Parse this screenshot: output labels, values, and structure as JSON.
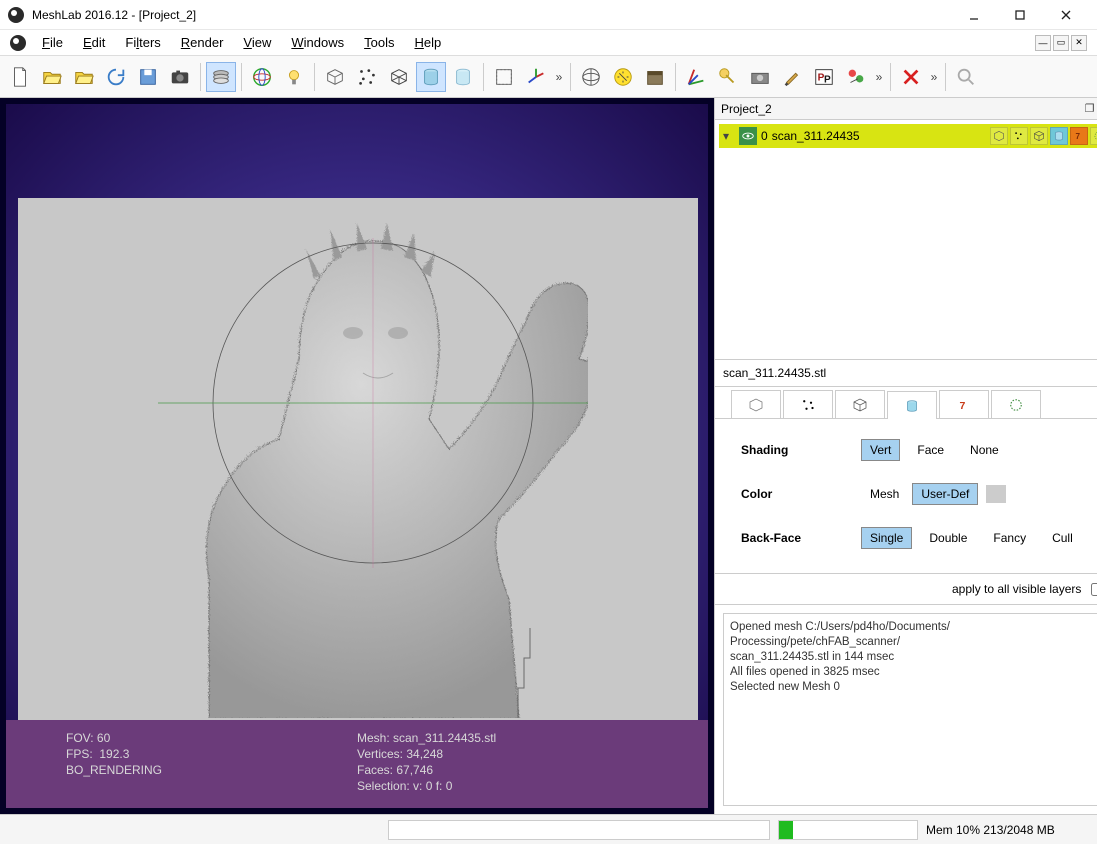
{
  "title": "MeshLab 2016.12 - [Project_2]",
  "menu": [
    "File",
    "Edit",
    "Filters",
    "Render",
    "View",
    "Windows",
    "Tools",
    "Help"
  ],
  "panel": {
    "title": "Project_2",
    "layer": {
      "index": "0",
      "name": "scan_311.24435"
    },
    "mesh_label": "scan_311.24435.stl"
  },
  "shading": {
    "label": "Shading",
    "options": [
      "Vert",
      "Face",
      "None"
    ],
    "selected": "Vert"
  },
  "color": {
    "label": "Color",
    "mesh_label": "Mesh",
    "options": [
      "User-Def"
    ],
    "selected": "User-Def"
  },
  "backface": {
    "label": "Back-Face",
    "options": [
      "Single",
      "Double",
      "Fancy",
      "Cull"
    ],
    "selected": "Single"
  },
  "apply_label": "apply to all visible layers",
  "overlay": {
    "fov": "FOV: 60",
    "fps": "FPS:  192.3",
    "mode": "BO_RENDERING",
    "mesh": "Mesh: scan_311.24435.stl",
    "verts": "Vertices: 34,248",
    "faces": "Faces: 67,746",
    "sel": "Selection: v: 0 f: 0"
  },
  "log": [
    "Opened mesh C:/Users/pd4ho/Documents/",
    "Processing/pete/chFAB_scanner/",
    "scan_311.24435.stl in 144 msec",
    "All files opened in 3825 msec",
    "Selected new Mesh 0"
  ],
  "mem": "Mem 10% 213/2048 MB"
}
